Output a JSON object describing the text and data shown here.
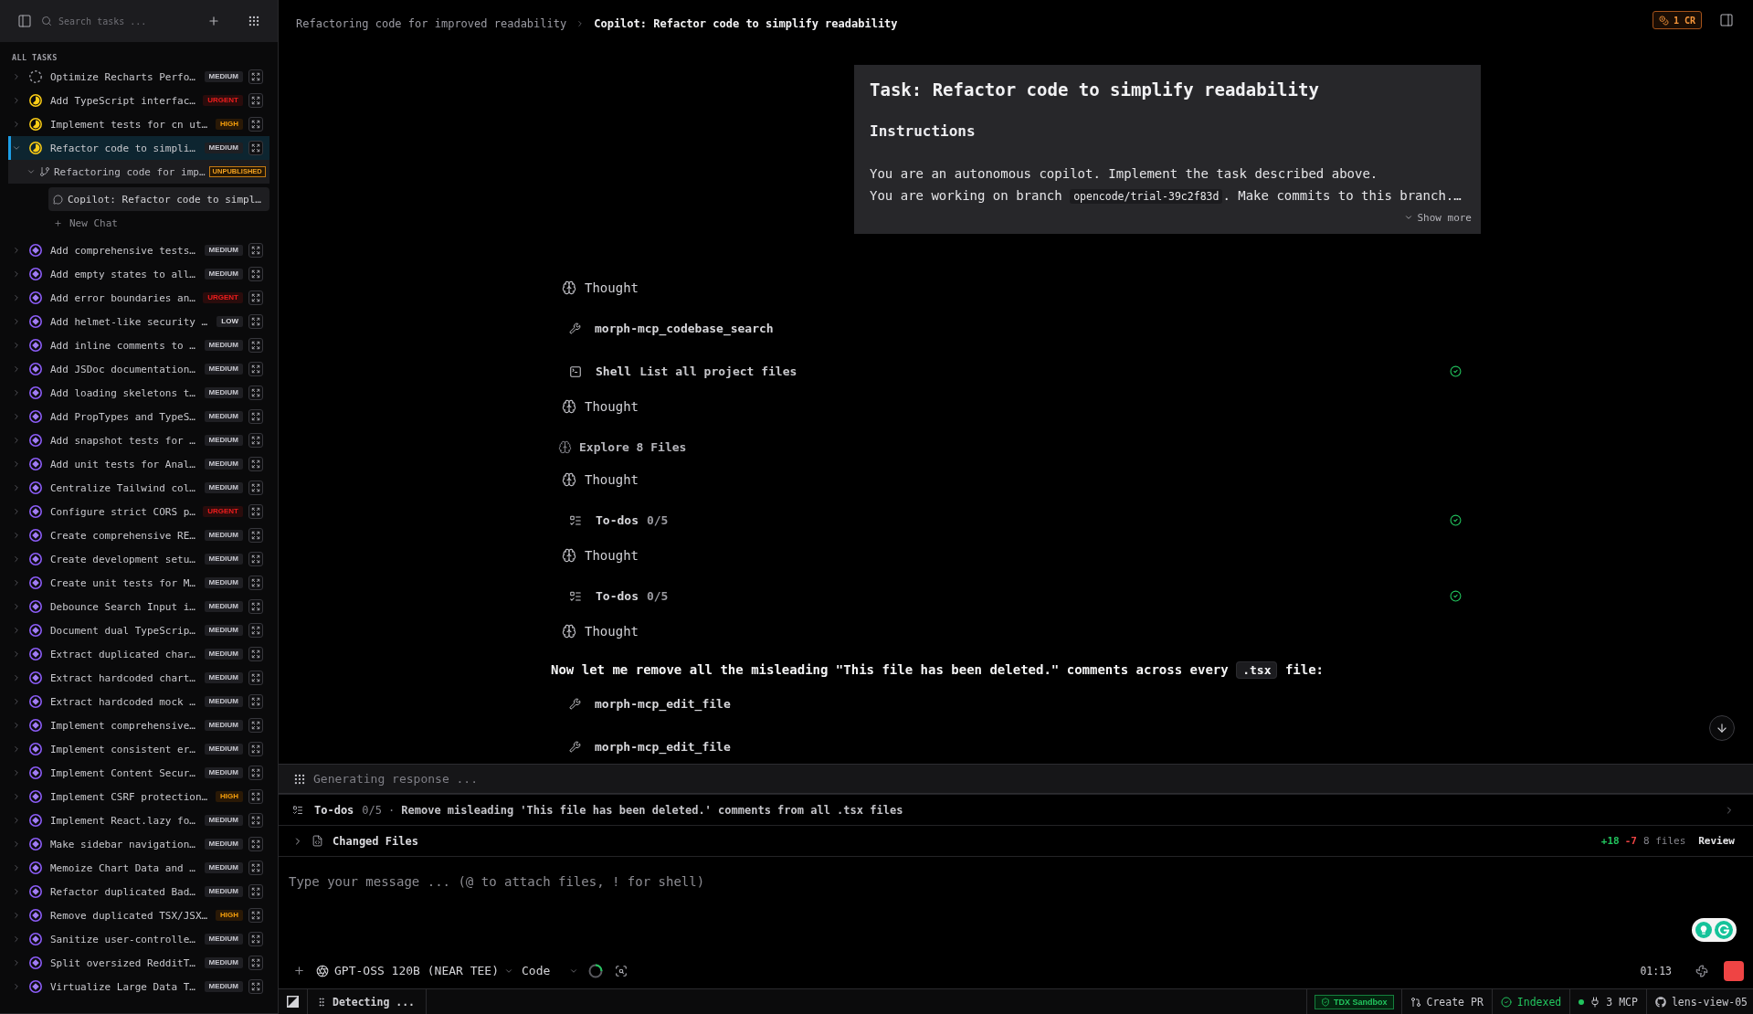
{
  "sidebar": {
    "search": {
      "placeholder": "Search tasks ..."
    },
    "section_title": "ALL TASKS",
    "tasks": [
      {
        "label": "Optimize Recharts Perfo…",
        "kind": "todo",
        "priority": {
          "label": "MEDIUM",
          "kind": "medium"
        },
        "expanded": false,
        "selected": false
      },
      {
        "label": "Add TypeScript interfac…",
        "kind": "in_progress",
        "priority": {
          "label": "URGENT",
          "kind": "urgent"
        },
        "expanded": false,
        "selected": false
      },
      {
        "label": "Implement tests for cn ut…",
        "kind": "in_progress",
        "priority": {
          "label": "HIGH",
          "kind": "high"
        },
        "expanded": false,
        "selected": false
      },
      {
        "label": "Refactor code to simpli…",
        "kind": "in_progress",
        "priority": {
          "label": "MEDIUM",
          "kind": "medium"
        },
        "expanded": true,
        "selected": true,
        "children": [
          {
            "label": "Refactoring code for imp…",
            "badge": "UNPUBLISHED",
            "expanded": true,
            "children": [
              {
                "label": "Copilot: Refactor code to simpl…",
                "selected": true
              }
            ],
            "new_chat": "New Chat"
          }
        ]
      },
      {
        "label": "Add comprehensive tests…",
        "kind": "queued",
        "priority": {
          "label": "MEDIUM",
          "kind": "medium"
        },
        "expanded": false,
        "selected": false
      },
      {
        "label": "Add empty states to all…",
        "kind": "queued",
        "priority": {
          "label": "MEDIUM",
          "kind": "medium"
        },
        "expanded": false,
        "selected": false
      },
      {
        "label": "Add error boundaries an…",
        "kind": "queued",
        "priority": {
          "label": "URGENT",
          "kind": "urgent"
        },
        "expanded": false,
        "selected": false
      },
      {
        "label": "Add helmet-like security …",
        "kind": "queued",
        "priority": {
          "label": "LOW",
          "kind": "low"
        },
        "expanded": false,
        "selected": false
      },
      {
        "label": "Add inline comments to …",
        "kind": "queued",
        "priority": {
          "label": "MEDIUM",
          "kind": "medium"
        },
        "expanded": false,
        "selected": false
      },
      {
        "label": "Add JSDoc documentation…",
        "kind": "queued",
        "priority": {
          "label": "MEDIUM",
          "kind": "medium"
        },
        "expanded": false,
        "selected": false
      },
      {
        "label": "Add loading skeletons t…",
        "kind": "queued",
        "priority": {
          "label": "MEDIUM",
          "kind": "medium"
        },
        "expanded": false,
        "selected": false
      },
      {
        "label": "Add PropTypes and TypeS…",
        "kind": "queued",
        "priority": {
          "label": "MEDIUM",
          "kind": "medium"
        },
        "expanded": false,
        "selected": false
      },
      {
        "label": "Add snapshot tests for …",
        "kind": "queued",
        "priority": {
          "label": "MEDIUM",
          "kind": "medium"
        },
        "expanded": false,
        "selected": false
      },
      {
        "label": "Add unit tests for Anal…",
        "kind": "queued",
        "priority": {
          "label": "MEDIUM",
          "kind": "medium"
        },
        "expanded": false,
        "selected": false
      },
      {
        "label": "Centralize Tailwind col…",
        "kind": "queued",
        "priority": {
          "label": "MEDIUM",
          "kind": "medium"
        },
        "expanded": false,
        "selected": false
      },
      {
        "label": "Configure strict CORS p…",
        "kind": "queued",
        "priority": {
          "label": "URGENT",
          "kind": "urgent"
        },
        "expanded": false,
        "selected": false
      },
      {
        "label": "Create comprehensive RE…",
        "kind": "queued",
        "priority": {
          "label": "MEDIUM",
          "kind": "medium"
        },
        "expanded": false,
        "selected": false
      },
      {
        "label": "Create development setu…",
        "kind": "queued",
        "priority": {
          "label": "MEDIUM",
          "kind": "medium"
        },
        "expanded": false,
        "selected": false
      },
      {
        "label": "Create unit tests for M…",
        "kind": "queued",
        "priority": {
          "label": "MEDIUM",
          "kind": "medium"
        },
        "expanded": false,
        "selected": false
      },
      {
        "label": "Debounce Search Input i…",
        "kind": "queued",
        "priority": {
          "label": "MEDIUM",
          "kind": "medium"
        },
        "expanded": false,
        "selected": false
      },
      {
        "label": "Document dual TypeScrip…",
        "kind": "queued",
        "priority": {
          "label": "MEDIUM",
          "kind": "medium"
        },
        "expanded": false,
        "selected": false
      },
      {
        "label": "Extract duplicated char…",
        "kind": "queued",
        "priority": {
          "label": "MEDIUM",
          "kind": "medium"
        },
        "expanded": false,
        "selected": false
      },
      {
        "label": "Extract hardcoded chart…",
        "kind": "queued",
        "priority": {
          "label": "MEDIUM",
          "kind": "medium"
        },
        "expanded": false,
        "selected": false
      },
      {
        "label": "Extract hardcoded mock …",
        "kind": "queued",
        "priority": {
          "label": "MEDIUM",
          "kind": "medium"
        },
        "expanded": false,
        "selected": false
      },
      {
        "label": "Implement comprehensive…",
        "kind": "queued",
        "priority": {
          "label": "MEDIUM",
          "kind": "medium"
        },
        "expanded": false,
        "selected": false
      },
      {
        "label": "Implement consistent er…",
        "kind": "queued",
        "priority": {
          "label": "MEDIUM",
          "kind": "medium"
        },
        "expanded": false,
        "selected": false
      },
      {
        "label": "Implement Content Secur…",
        "kind": "queued",
        "priority": {
          "label": "MEDIUM",
          "kind": "medium"
        },
        "expanded": false,
        "selected": false
      },
      {
        "label": "Implement CSRF protection…",
        "kind": "queued",
        "priority": {
          "label": "HIGH",
          "kind": "high"
        },
        "expanded": false,
        "selected": false
      },
      {
        "label": "Implement React.lazy fo…",
        "kind": "queued",
        "priority": {
          "label": "MEDIUM",
          "kind": "medium"
        },
        "expanded": false,
        "selected": false
      },
      {
        "label": "Make sidebar navigation…",
        "kind": "queued",
        "priority": {
          "label": "MEDIUM",
          "kind": "medium"
        },
        "expanded": false,
        "selected": false
      },
      {
        "label": "Memoize Chart Data and …",
        "kind": "queued",
        "priority": {
          "label": "MEDIUM",
          "kind": "medium"
        },
        "expanded": false,
        "selected": false
      },
      {
        "label": "Refactor duplicated Bad…",
        "kind": "queued",
        "priority": {
          "label": "MEDIUM",
          "kind": "medium"
        },
        "expanded": false,
        "selected": false
      },
      {
        "label": "Remove duplicated TSX/JSX…",
        "kind": "queued",
        "priority": {
          "label": "HIGH",
          "kind": "high"
        },
        "expanded": false,
        "selected": false
      },
      {
        "label": "Sanitize user-controlle…",
        "kind": "queued",
        "priority": {
          "label": "MEDIUM",
          "kind": "medium"
        },
        "expanded": false,
        "selected": false
      },
      {
        "label": "Split oversized RedditT…",
        "kind": "queued",
        "priority": {
          "label": "MEDIUM",
          "kind": "medium"
        },
        "expanded": false,
        "selected": false
      },
      {
        "label": "Virtualize Large Data T…",
        "kind": "queued",
        "priority": {
          "label": "MEDIUM",
          "kind": "medium"
        },
        "expanded": false,
        "selected": false
      }
    ]
  },
  "header": {
    "breadcrumb": [
      {
        "label": "Refactoring code for improved readability",
        "current": false
      },
      {
        "label": "Copilot: Refactor code to simplify readability",
        "current": true
      }
    ],
    "credits": "1 CR"
  },
  "task_card": {
    "title": "Task: Refactor code to simplify readability",
    "heading": "Instructions",
    "lines": [
      [
        {
          "kind": "text",
          "text": "You are an autonomous copilot. Implement the task described above."
        }
      ],
      [
        {
          "kind": "text",
          "text": "You are working on branch "
        },
        {
          "kind": "code",
          "text": "opencode/trial-39c2f83d"
        },
        {
          "kind": "text",
          "text": ". Make commits to this branch.…"
        }
      ]
    ],
    "show_more": "Show more"
  },
  "transcript": [
    {
      "kind": "thought",
      "label": "Thought"
    },
    {
      "kind": "tool",
      "name": "morph-mcp_codebase_search",
      "completed": false
    },
    {
      "kind": "shell",
      "name": "Shell",
      "detail": "List all project files",
      "completed": true
    },
    {
      "kind": "thought",
      "label": "Thought"
    },
    {
      "kind": "explore",
      "label": "Explore 8 Files"
    },
    {
      "kind": "thought",
      "label": "Thought"
    },
    {
      "kind": "todos",
      "name": "To-dos",
      "detail": "0/5",
      "completed": true
    },
    {
      "kind": "thought",
      "label": "Thought"
    },
    {
      "kind": "todos",
      "name": "To-dos",
      "detail": "0/5",
      "completed": true
    },
    {
      "kind": "thought",
      "label": "Thought"
    },
    {
      "kind": "message",
      "parts": [
        {
          "kind": "text",
          "text": "Now let me remove all the misleading \"This file has been deleted.\" comments across every "
        },
        {
          "kind": "code",
          "text": ".tsx"
        },
        {
          "kind": "text",
          "text": " file:"
        }
      ]
    },
    {
      "kind": "tool",
      "name": "morph-mcp_edit_file",
      "completed": false
    },
    {
      "kind": "tool",
      "name": "morph-mcp_edit_file",
      "completed": false
    }
  ],
  "composer": {
    "status": "Generating response ...",
    "todos": {
      "name": "To-dos",
      "count": "0/5",
      "separator": "·",
      "current": "Remove misleading 'This file has been deleted.' comments from all .tsx files"
    },
    "changed_files": {
      "label": "Changed Files",
      "expanded": false,
      "additions": "+18",
      "deletions": "-7",
      "files": "8 files",
      "review": "Review"
    },
    "input": {
      "placeholder": "Type your message ... (@ to attach files, ! for shell)"
    },
    "model": "GPT-OSS 120B (NEAR TEE)",
    "mode": "Code",
    "timer": "01:13"
  },
  "status_bar": {
    "activity": "Detecting ...",
    "items": [
      {
        "kind": "sandbox",
        "label": "TDX Sandbox"
      },
      {
        "kind": "pull_request",
        "label": "Create PR"
      },
      {
        "kind": "indexed",
        "label": "Indexed"
      },
      {
        "kind": "mcp",
        "label": "3 MCP"
      },
      {
        "kind": "branch",
        "label": "lens-view-05"
      }
    ]
  }
}
